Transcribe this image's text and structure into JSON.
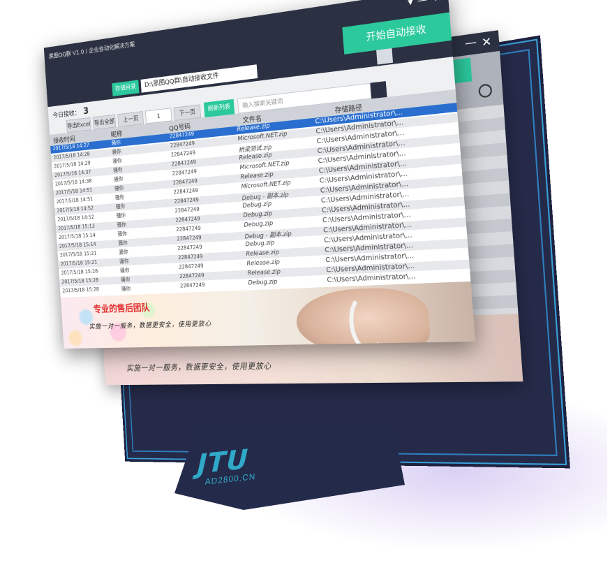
{
  "app": {
    "title": "黑图QQ群 V1.0 / 企业自动化解决方案",
    "minimize_glyph": "▾",
    "min_glyph": "—",
    "close_glyph": "✕"
  },
  "toolbar": {
    "path_button": "存储目录",
    "path_value": "D:\\黑图QQ群\\自动接收文件",
    "start_button": "开始自动接收",
    "today_label": "今日接收：",
    "today_count": "3",
    "export_excel": "导出Excel",
    "export_all": "导出全部",
    "prev_page": "上一页",
    "page_number": "1",
    "next_page": "下一页",
    "refresh_list": "刷新列表",
    "search_placeholder": "输入搜索关键词"
  },
  "table": {
    "columns": [
      "接收时间",
      "昵称",
      "QQ号码",
      "文件名",
      "存储路径"
    ],
    "rows": [
      {
        "time": "2017/5/18 14:27",
        "nick": "骚你",
        "qq": "22847249",
        "file": "Release.zip",
        "path": "C:\\Users\\Administrator\\..."
      },
      {
        "time": "2017/5/18 14:28",
        "nick": "骚你",
        "qq": "22847249",
        "file": "Microsoft.NET.zip",
        "path": "C:\\Users\\Administrator\\..."
      },
      {
        "time": "2017/5/18 14:29",
        "nick": "骚你",
        "qq": "22847249",
        "file": "桥梁测试.zip",
        "path": "C:\\Users\\Administrator\\..."
      },
      {
        "time": "2017/5/18 14:37",
        "nick": "骚你",
        "qq": "22847249",
        "file": "Release.zip",
        "path": "C:\\Users\\Administrator\\..."
      },
      {
        "time": "2017/5/18 14:38",
        "nick": "骚你",
        "qq": "22847249",
        "file": "Microsoft.NET.zip",
        "path": "C:\\Users\\Administrator\\..."
      },
      {
        "time": "2017/5/18 14:51",
        "nick": "骚你",
        "qq": "22847249",
        "file": "Release.zip",
        "path": "C:\\Users\\Administrator\\..."
      },
      {
        "time": "2017/5/18 14:51",
        "nick": "骚你",
        "qq": "22847249",
        "file": "Microsoft.NET.zip",
        "path": "C:\\Users\\Administrator\\..."
      },
      {
        "time": "2017/5/18 14:52",
        "nick": "骚你",
        "qq": "22847249",
        "file": "Debug - 副本.zip",
        "path": "C:\\Users\\Administrator\\..."
      },
      {
        "time": "2017/5/18 14:52",
        "nick": "骚你",
        "qq": "22847249",
        "file": "Debug.zip",
        "path": "C:\\Users\\Administrator\\..."
      },
      {
        "time": "2017/5/18 15:13",
        "nick": "骚你",
        "qq": "22847249",
        "file": "Debug.zip",
        "path": "C:\\Users\\Administrator\\..."
      },
      {
        "time": "2017/5/18 15:14",
        "nick": "骚你",
        "qq": "22847249",
        "file": "Debug.zip",
        "path": "C:\\Users\\Administrator\\..."
      },
      {
        "time": "2017/5/18 15:14",
        "nick": "骚你",
        "qq": "22847249",
        "file": "Debug - 副本.zip",
        "path": "C:\\Users\\Administrator\\..."
      },
      {
        "time": "2017/5/18 15:21",
        "nick": "骚你",
        "qq": "22847249",
        "file": "Debug.zip",
        "path": "C:\\Users\\Administrator\\..."
      },
      {
        "time": "2017/5/18 15:21",
        "nick": "骚你",
        "qq": "22847249",
        "file": "Release.zip",
        "path": "C:\\Users\\Administrator\\..."
      },
      {
        "time": "2017/5/18 15:28",
        "nick": "骚你",
        "qq": "22847249",
        "file": "Release.zip",
        "path": "C:\\Users\\Administrator\\..."
      },
      {
        "time": "2017/5/18 15:28",
        "nick": "骚你",
        "qq": "22847249",
        "file": "Release.zip",
        "path": "C:\\Users\\Administrator\\..."
      },
      {
        "time": "2017/5/18 15:28",
        "nick": "骚你",
        "qq": "22847249",
        "file": "Debug.zip",
        "path": "C:\\Users\\Administrator\\..."
      }
    ]
  },
  "banner": {
    "headline": "专业的售后团队",
    "tagline": "实施一对一服务，数据更安全，使用更放心"
  },
  "back_window": {
    "tagline": "实施一对一服务，数据更安全，使用更放心"
  },
  "brand": {
    "logo": "JTU",
    "domain": "AD2800.CN"
  },
  "colors": {
    "accent": "#2bc99c",
    "titlebar": "#2b3142",
    "selection": "#2a6fd0",
    "headline": "#e02a2a",
    "monitor": "#252a49",
    "logo": "#30a8c8"
  }
}
